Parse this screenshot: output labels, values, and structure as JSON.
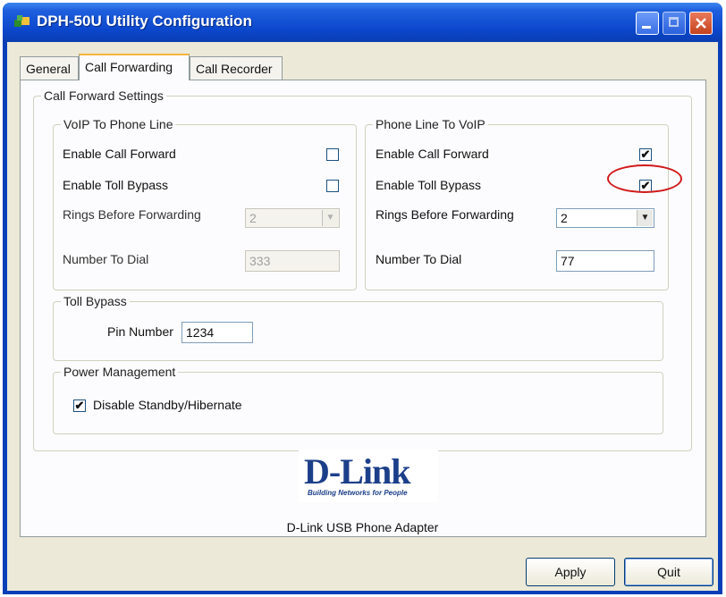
{
  "window": {
    "title": "DPH-50U Utility Configuration"
  },
  "tabs": [
    {
      "label": "General"
    },
    {
      "label": "Call Forwarding"
    },
    {
      "label": "Call Recorder"
    }
  ],
  "call_forward_settings": {
    "label": "Call Forward Settings",
    "voip_to_phone": {
      "label": "VoIP To Phone Line",
      "enable_call_forward_label": "Enable Call Forward",
      "enable_call_forward_checked": false,
      "enable_toll_bypass_label": "Enable Toll Bypass",
      "enable_toll_bypass_checked": false,
      "rings_label": "Rings Before Forwarding",
      "rings_value": "2",
      "number_label": "Number To Dial",
      "number_value": "333"
    },
    "phone_to_voip": {
      "label": "Phone Line To VoIP",
      "enable_call_forward_label": "Enable Call Forward",
      "enable_call_forward_checked": true,
      "enable_toll_bypass_label": "Enable Toll Bypass",
      "enable_toll_bypass_checked": true,
      "rings_label": "Rings Before Forwarding",
      "rings_value": "2",
      "number_label": "Number To Dial",
      "number_value": "77"
    },
    "toll_bypass": {
      "label": "Toll Bypass",
      "pin_label": "Pin Number",
      "pin_value": "1234"
    },
    "power_management": {
      "label": "Power Management",
      "disable_standby_label": "Disable Standby/Hibernate",
      "disable_standby_checked": true
    }
  },
  "logo": {
    "brand": "D-Link",
    "tagline": "Building Networks for People"
  },
  "product_name": "D-Link USB Phone Adapter",
  "buttons": {
    "apply": "Apply",
    "quit": "Quit"
  },
  "check_glyph": "✔",
  "colors": {
    "titlebar": "#0b47cc",
    "highlight": "#d11a1a",
    "logo": "#1c3f8a"
  }
}
